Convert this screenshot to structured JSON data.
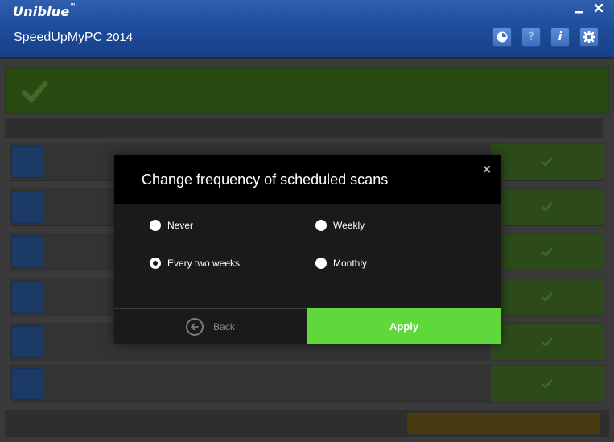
{
  "app": {
    "brand": "Uniblue",
    "trademark": "™",
    "product": "SpeedUpMyPC",
    "year": "2014"
  },
  "window_controls": {
    "minimize_icon": "minimize-icon",
    "close_icon": "close-icon"
  },
  "toolbar": [
    {
      "icon": "clock-icon"
    },
    {
      "icon": "help-icon",
      "glyph": "?"
    },
    {
      "icon": "info-icon",
      "glyph": "i"
    },
    {
      "icon": "gear-icon"
    }
  ],
  "dialog": {
    "title": "Change frequency of scheduled scans",
    "close_glyph": "×",
    "options": {
      "never": "Never",
      "weekly": "Weekly",
      "every_two_weeks": "Every two weeks",
      "monthly": "Monthly"
    },
    "selected": "every_two_weeks",
    "back_label": "Back",
    "apply_label": "Apply"
  },
  "colors": {
    "titlebar": "#1d4c9c",
    "apply": "#5ed83a",
    "dialog_header": "#000000",
    "dialog_body": "#1a1a1a"
  }
}
